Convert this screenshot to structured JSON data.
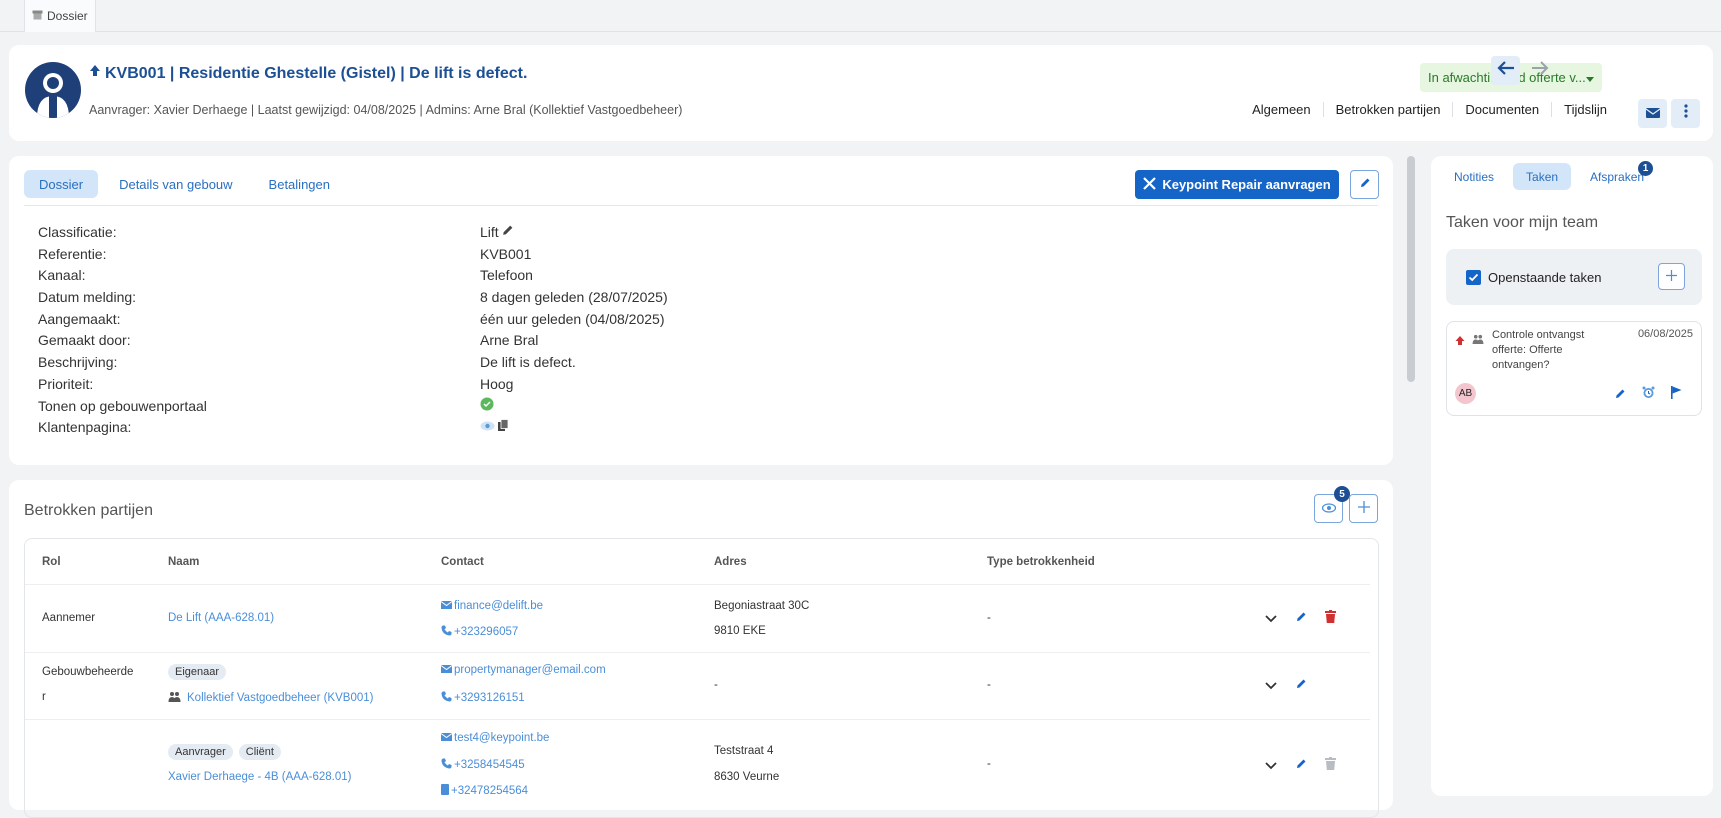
{
  "topbar": {
    "tab_label": "Dossier"
  },
  "header": {
    "title": "KVB001 | Residentie Ghestelle (Gistel) | De lift is defect.",
    "subtitle": "Aanvrager: Xavier Derhaege | Laatst gewijzigd: 04/08/2025 | Admins: Arne Bral (Kollektief Vastgoedbeheer)",
    "status": "In afwachting v/d offerte v...",
    "nav": [
      "Algemeen",
      "Betrokken partijen",
      "Documenten",
      "Tijdslijn"
    ]
  },
  "main": {
    "tabs": [
      "Dossier",
      "Details van gebouw",
      "Betalingen"
    ],
    "keypoint_button": "Keypoint Repair aanvragen",
    "details": [
      {
        "key": "Classificatie:",
        "value": "Lift"
      },
      {
        "key": "Referentie:",
        "value": "KVB001"
      },
      {
        "key": "Kanaal:",
        "value": "Telefoon"
      },
      {
        "key": "Datum melding:",
        "value": "8 dagen geleden (28/07/2025)"
      },
      {
        "key": "Aangemaakt:",
        "value": "één uur geleden (04/08/2025)"
      },
      {
        "key": "Gemaakt door:",
        "value": "Arne Bral"
      },
      {
        "key": "Beschrijving:",
        "value": "De lift is defect."
      },
      {
        "key": "Prioriteit:",
        "value": "Hoog"
      },
      {
        "key": "Tonen op gebouwenportaal",
        "value": ""
      },
      {
        "key": "Klantenpagina:",
        "value": ""
      }
    ]
  },
  "parties": {
    "title": "Betrokken partijen",
    "visible_count": "5",
    "columns": [
      "Rol",
      "Naam",
      "Contact",
      "Adres",
      "Type betrokkenheid"
    ],
    "rows": [
      {
        "role": "Aannemer",
        "name": "De Lift (AAA-628.01)",
        "email": "finance@delift.be",
        "phone": "+323296057",
        "addr1": "Begoniastraat 30C",
        "addr2": "9810 EKE",
        "type": "-"
      },
      {
        "role_line1": "Gebouwbeheerde",
        "role_line2": "r",
        "badge": "Eigenaar",
        "name": "Kollektief Vastgoedbeheer (KVB001)",
        "email": "propertymanager@email.com",
        "phone": "+3293126151",
        "addr": "-",
        "type": "-"
      },
      {
        "badges": [
          "Aanvrager",
          "Cliënt"
        ],
        "name": "Xavier Derhaege - 4B (AAA-628.01)",
        "email": "test4@keypoint.be",
        "phone": "+3258454545",
        "phone2": "+32478254564",
        "addr1": "Teststraat 4",
        "addr2": "8630 Veurne",
        "type": "-"
      }
    ]
  },
  "side": {
    "tabs": [
      "Notities",
      "Taken",
      "Afspraken"
    ],
    "afspraken_badge": "1",
    "title": "Taken voor mijn team",
    "open_tasks_label": "Openstaande taken",
    "task": {
      "text": "Controle ontvangst offerte: Offerte ontvangen?",
      "date": "06/08/2025",
      "avatar": "AB"
    }
  }
}
